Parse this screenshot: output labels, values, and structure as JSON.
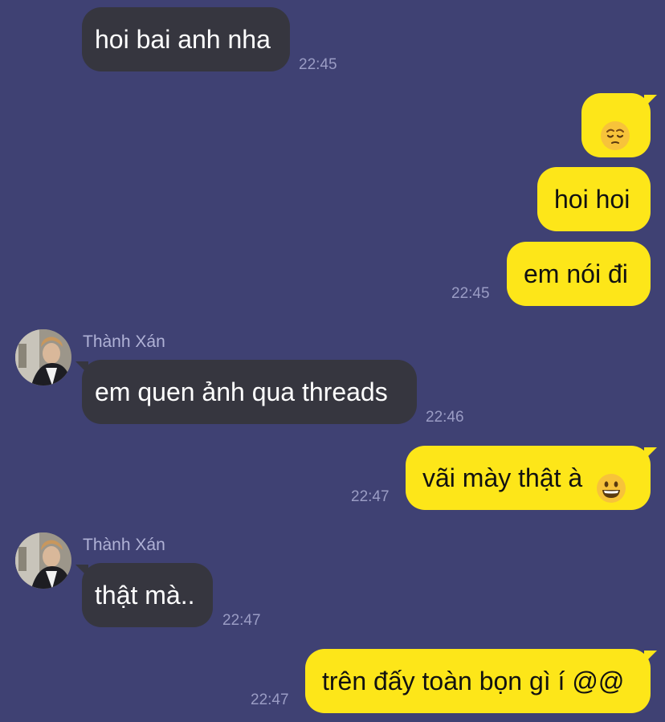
{
  "chat": {
    "background": "#3f4173",
    "incoming_bubble_color": "#36363f",
    "outgoing_bubble_color": "#fde619",
    "messages": [
      {
        "dir": "in",
        "text": "hoi bai anh nha",
        "time": "22:45"
      },
      {
        "dir": "out",
        "emoji": "pensive-face-emoji"
      },
      {
        "dir": "out",
        "text": "hoi hoi"
      },
      {
        "dir": "out",
        "text": "em nói đi",
        "time": "22:45"
      },
      {
        "dir": "in",
        "sender": "Thành Xán",
        "text": "em quen ảnh qua threads",
        "time": "22:46"
      },
      {
        "dir": "out",
        "text": "vãi mày thật à",
        "emoji": "grinning-face-emoji",
        "time": "22:47"
      },
      {
        "dir": "in",
        "sender": "Thành Xán",
        "text": "thật mà..",
        "time": "22:47"
      },
      {
        "dir": "out",
        "text": "trên đấy toàn bọn gì í @@",
        "time": "22:47"
      }
    ]
  }
}
